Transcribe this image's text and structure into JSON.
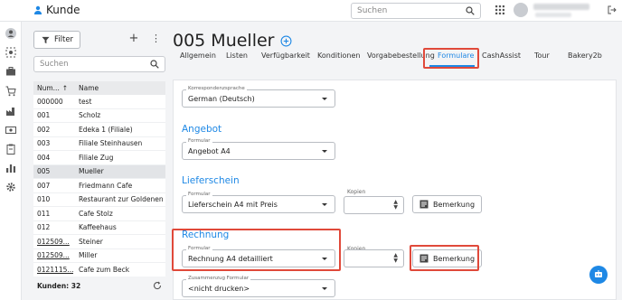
{
  "app": {
    "title": "Kunde"
  },
  "topbar": {
    "search_placeholder": "Suchen"
  },
  "left": {
    "filter_label": "Filter",
    "search_placeholder": "Suchen",
    "columns": [
      "Num...",
      "Name"
    ],
    "rows": [
      {
        "num": "000000",
        "name": "test",
        "underline": false
      },
      {
        "num": "001",
        "name": "Scholz",
        "underline": false
      },
      {
        "num": "002",
        "name": "Edeka 1 (Filiale)",
        "underline": false
      },
      {
        "num": "003",
        "name": "Filiale Steinhausen",
        "underline": false
      },
      {
        "num": "004",
        "name": "Filiale Zug",
        "underline": false
      },
      {
        "num": "005",
        "name": "Mueller",
        "underline": false
      },
      {
        "num": "007",
        "name": "Friedmann Cafe",
        "underline": false
      },
      {
        "num": "010",
        "name": "Restaurant zur Goldenen L...",
        "underline": false
      },
      {
        "num": "011",
        "name": "Cafe Stolz",
        "underline": false
      },
      {
        "num": "012",
        "name": "Kaffeehaus",
        "underline": false
      },
      {
        "num": "012509...",
        "name": "Steiner",
        "underline": true
      },
      {
        "num": "012509...",
        "name": "Miller",
        "underline": true
      },
      {
        "num": "0121115...",
        "name": "Cafe zum Beck",
        "underline": true
      }
    ],
    "selected_index": 5,
    "footer": "Kunden: 32"
  },
  "main": {
    "title": "005 Mueller",
    "tabs": [
      "Allgemein",
      "Listen",
      "Verfügbarkeit",
      "Konditionen",
      "Vorgabebestellung",
      "Formulare",
      "CashAssist",
      "Tour",
      "Bakery2b"
    ],
    "active_tab": "Formulare",
    "korrespondenz": {
      "label": "Korrespondenzsprache",
      "value": "German (Deutsch)"
    },
    "angebot": {
      "heading": "Angebot",
      "label": "Formular",
      "value": "Angebot A4"
    },
    "lieferschein": {
      "heading": "Lieferschein",
      "label": "Formular",
      "value": "Lieferschein A4 mit Preis",
      "kopien_label": "Kopien",
      "button": "Bemerkung"
    },
    "rechnung": {
      "heading": "Rechnung",
      "label": "Formular",
      "value": "Rechnung A4 detailliert",
      "kopien_label": "Kopien",
      "button": "Bemerkung"
    },
    "zusammenzug": {
      "label": "Zusammenzug Formular",
      "value": "<nicht drucken>"
    }
  },
  "colors": {
    "accent": "#1e88e5",
    "highlight": "#e0493a"
  }
}
